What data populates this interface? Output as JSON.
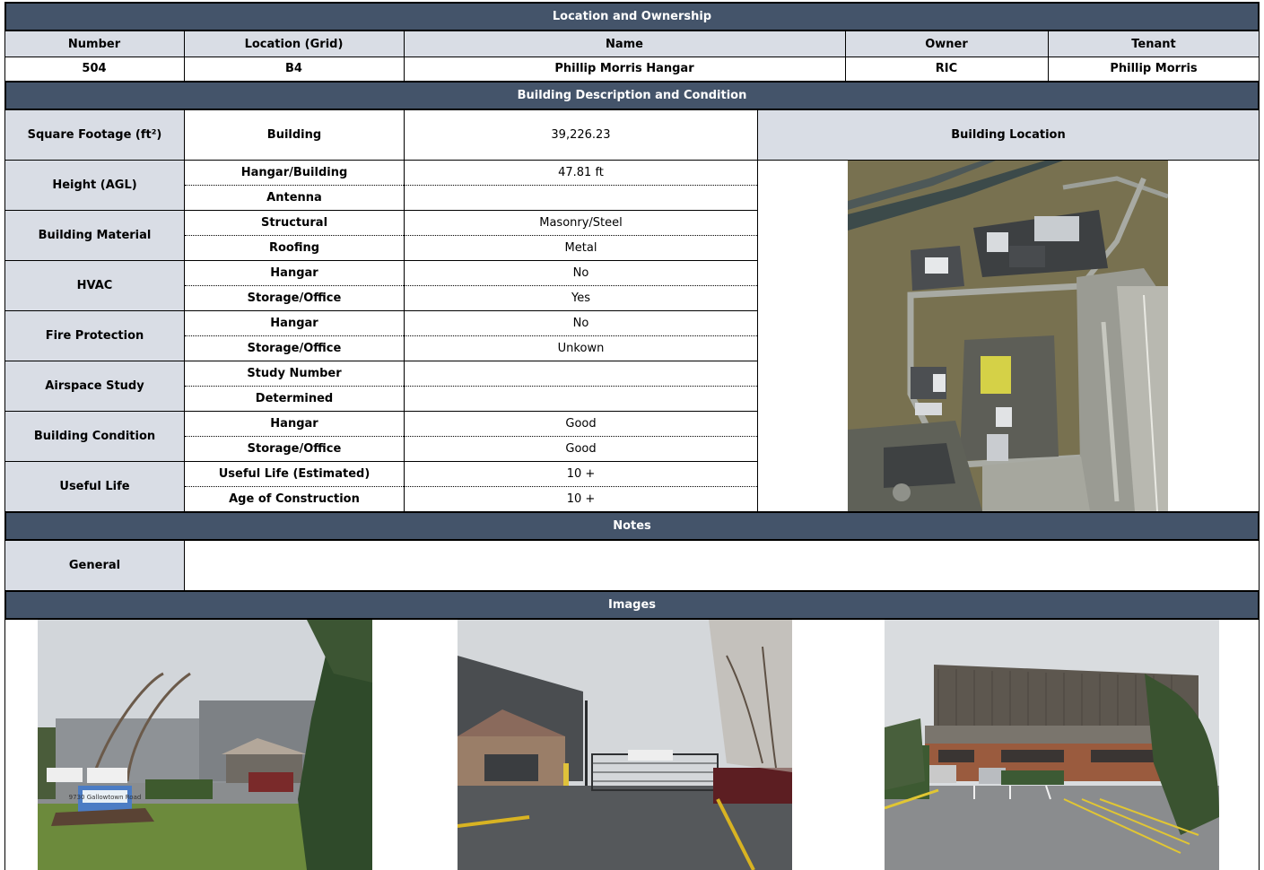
{
  "sections": {
    "ownership": "Location and Ownership",
    "description": "Building Description and Condition",
    "notes": "Notes",
    "images": "Images"
  },
  "ownership": {
    "headers": [
      "Number",
      "Location (Grid)",
      "Name",
      "Owner",
      "Tenant"
    ],
    "values": [
      "504",
      "B4",
      "Phillip Morris Hangar",
      "RIC",
      "Phillip Morris"
    ]
  },
  "square_footage": {
    "label": "Square Footage (ft²)",
    "sub": "Building",
    "value": "39,226.23"
  },
  "building_location_label": "Building Location",
  "groups": [
    {
      "label": "Height (AGL)",
      "rows": [
        {
          "sub": "Hangar/Building",
          "value": "47.81 ft"
        },
        {
          "sub": "Antenna",
          "value": ""
        }
      ]
    },
    {
      "label": "Building Material",
      "rows": [
        {
          "sub": "Structural",
          "value": "Masonry/Steel"
        },
        {
          "sub": "Roofing",
          "value": "Metal"
        }
      ]
    },
    {
      "label": "HVAC",
      "rows": [
        {
          "sub": "Hangar",
          "value": "No"
        },
        {
          "sub": "Storage/Office",
          "value": "Yes"
        }
      ]
    },
    {
      "label": "Fire Protection",
      "rows": [
        {
          "sub": "Hangar",
          "value": "No"
        },
        {
          "sub": "Storage/Office",
          "value": "Unkown"
        }
      ]
    },
    {
      "label": "Airspace Study",
      "rows": [
        {
          "sub": "Study Number",
          "value": ""
        },
        {
          "sub": "Determined",
          "value": ""
        }
      ]
    },
    {
      "label": "Building Condition",
      "rows": [
        {
          "sub": "Hangar",
          "value": "Good"
        },
        {
          "sub": "Storage/Office",
          "value": "Good"
        }
      ]
    },
    {
      "label": "Useful Life",
      "rows": [
        {
          "sub": "Useful Life (Estimated)",
          "value": "10 +"
        },
        {
          "sub": "Age of Construction",
          "value": "10 +"
        }
      ]
    }
  ],
  "notes": {
    "label": "General",
    "value": ""
  },
  "photo_texts": {
    "sign": "9730 Gallowtown Road"
  },
  "colors": {
    "header_bg": "#44546a",
    "label_bg": "#d9dde5"
  }
}
